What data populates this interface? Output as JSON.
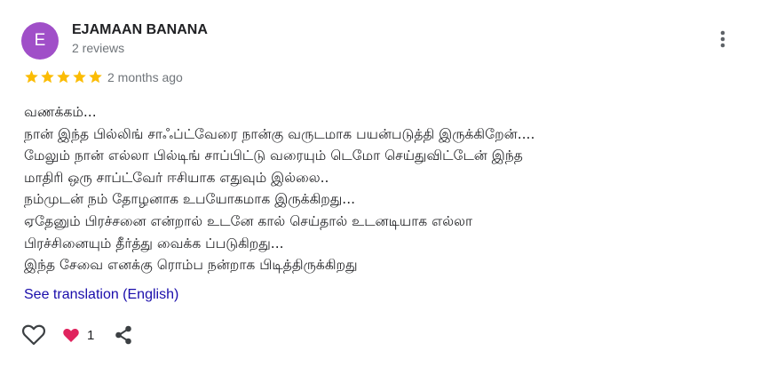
{
  "review": {
    "reviewer": {
      "avatar_letter": "E",
      "avatar_color": "#a04fc8",
      "name": "EJAMAAN BANANA",
      "meta": "2 reviews"
    },
    "rating": 5,
    "rating_max": 5,
    "star_color": "#fbbc04",
    "date": "2 months ago",
    "text_lines": [
      "வணக்கம்...",
      "நான் இந்த பில்லிங் சாஃப்ட்வேரை நான்கு வருடமாக பயன்படுத்தி இருக்கிறேன்....",
      "மேலும் நான் எல்லா பில்டிங் சாப்பிட்டு வரையும் டெமோ செய்துவிட்டேன் இந்த",
      "மாதிரி ஒரு சாப்ட்வேர் ஈசியாக எதுவும் இல்லை..",
      "நம்முடன் நம் தோழனாக உபயோகமாக இருக்கிறது...",
      "ஏதேனும் பிரச்சனை என்றால் உடனே கால் செய்தால் உடனடியாக எல்லா",
      "பிரச்சினையும் தீர்த்து வைக்க ப்படுகிறது...",
      "இந்த சேவை எனக்கு ரொம்ப நன்றாக பிடித்திருக்கிறது"
    ],
    "translate_link": "See translation (English)",
    "link_color": "#1a0dab",
    "actions": {
      "like_icon": "heart-outline-icon",
      "reaction_icon": "heart-filled-icon",
      "reaction_color": "#e0245e",
      "reaction_count": "1",
      "share_icon": "share-icon",
      "more_icon": "more-vertical-icon"
    }
  }
}
